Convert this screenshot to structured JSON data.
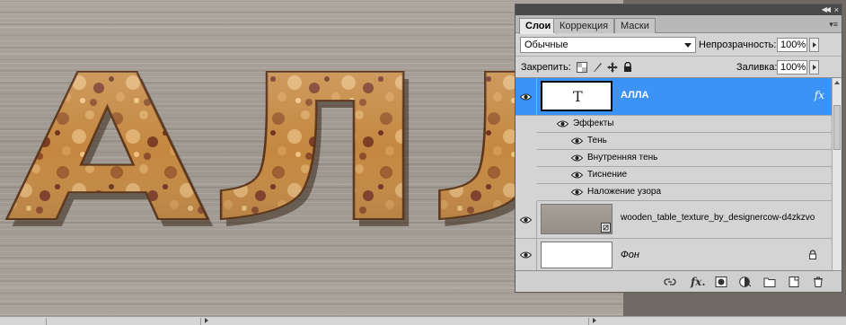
{
  "canvas": {
    "artwork_text": "АЛЛА"
  },
  "panel": {
    "tabs": [
      {
        "label": "Слои",
        "active": true
      },
      {
        "label": "Коррекция",
        "active": false
      },
      {
        "label": "Маски",
        "active": false
      }
    ],
    "blend_mode": "Обычные",
    "opacity_label": "Непрозрачность:",
    "opacity_value": "100%",
    "lock_label": "Закрепить:",
    "fill_label": "Заливка:",
    "fill_value": "100%",
    "layers": [
      {
        "name": "АЛЛА",
        "type": "text",
        "thumb_glyph": "T",
        "selected": true,
        "fx": "fx",
        "effects_header": "Эффекты",
        "effects": [
          "Тень",
          "Внутренняя тень",
          "Тиснение",
          "Наложение узора"
        ]
      },
      {
        "name": "wooden_table_texture_by_designercow-d4zkzvo",
        "type": "smart-object",
        "selected": false
      },
      {
        "name": "Фон",
        "type": "background",
        "selected": false,
        "locked": true
      }
    ]
  },
  "icons": {
    "eye": "eye-icon",
    "lock": "lock-icon",
    "link": "link-layers-icon",
    "fx": "layer-style-icon",
    "mask": "add-mask-icon",
    "adjust": "adjustment-layer-icon",
    "group": "new-group-icon",
    "new": "new-layer-icon",
    "trash": "delete-layer-icon"
  },
  "colors": {
    "selected_row": "#3a93f5",
    "panel_bg": "#d4d4d4",
    "cookie_fill": "#b97a38"
  }
}
